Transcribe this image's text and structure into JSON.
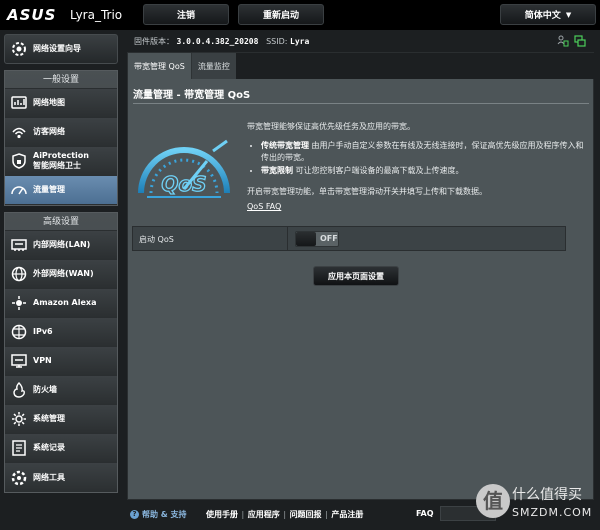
{
  "header": {
    "brand": "ASUS",
    "model": "Lyra_Trio",
    "logout_label": "注销",
    "reboot_label": "重新启动",
    "language": "简体中文"
  },
  "status": {
    "firmware_label": "固件版本：",
    "firmware_value": "3.0.0.4.382_20208",
    "ssid_label": "SSID:",
    "ssid_value": "Lyra"
  },
  "sidebar": {
    "wizard_label": "网络设置向导",
    "general_title": "一般设置",
    "general_items": [
      {
        "label": "网络地图",
        "icon": "network-map-icon"
      },
      {
        "label": "访客网络",
        "icon": "guest-network-icon"
      },
      {
        "label1": "AiProtection",
        "label2": "智能网络卫士",
        "icon": "aiprotection-icon"
      },
      {
        "label": "流量管理",
        "icon": "traffic-manager-icon",
        "active": true
      }
    ],
    "advanced_title": "高级设置",
    "advanced_items": [
      {
        "label": "内部网络(LAN)",
        "icon": "lan-icon"
      },
      {
        "label": "外部网络(WAN)",
        "icon": "wan-icon"
      },
      {
        "label": "Amazon Alexa",
        "icon": "alexa-icon"
      },
      {
        "label": "IPv6",
        "icon": "ipv6-icon"
      },
      {
        "label": "VPN",
        "icon": "vpn-icon"
      },
      {
        "label": "防火墙",
        "icon": "firewall-icon"
      },
      {
        "label": "系统管理",
        "icon": "administration-icon"
      },
      {
        "label": "系统记录",
        "icon": "system-log-icon"
      },
      {
        "label": "网络工具",
        "icon": "network-tools-icon"
      }
    ]
  },
  "main": {
    "tabs": [
      {
        "label": "带宽管理 QoS",
        "active": true
      },
      {
        "label": "流量监控",
        "active": false
      }
    ],
    "title": "流量管理 - 带宽管理 QoS",
    "intro": "带宽管理能够保证高优先级任务及应用的带宽。",
    "bullets": [
      {
        "bold": "传统带宽管理",
        "text": " 由用户手动自定义参数在有线及无线连接时，保证高优先级应用及程序传入和传出的带宽。"
      },
      {
        "bold": "带宽限制",
        "text": " 可让您控制客户端设备的最高下载及上传速度。"
      }
    ],
    "para2": "开启带宽管理功能，单击带宽管理滑动开关并填写上传和下载数据。",
    "faq_link": "QoS FAQ",
    "enable_label": "启动 QoS",
    "toggle_state": "OFF",
    "apply_label": "应用本页面设置",
    "gauge_text": "QoS"
  },
  "footer": {
    "help_label": "帮助 & 支持",
    "links": [
      "使用手册",
      "应用程序",
      "问题回报",
      "产品注册"
    ],
    "faq_label": "FAQ"
  },
  "watermark": {
    "logo_char": "值",
    "line1": "什么值得买",
    "line2": "SMZDM.COM"
  },
  "colors": {
    "accent_blue": "#3aa4dc",
    "active_nav": "#5a7ea3",
    "panel": "#4d5558"
  }
}
